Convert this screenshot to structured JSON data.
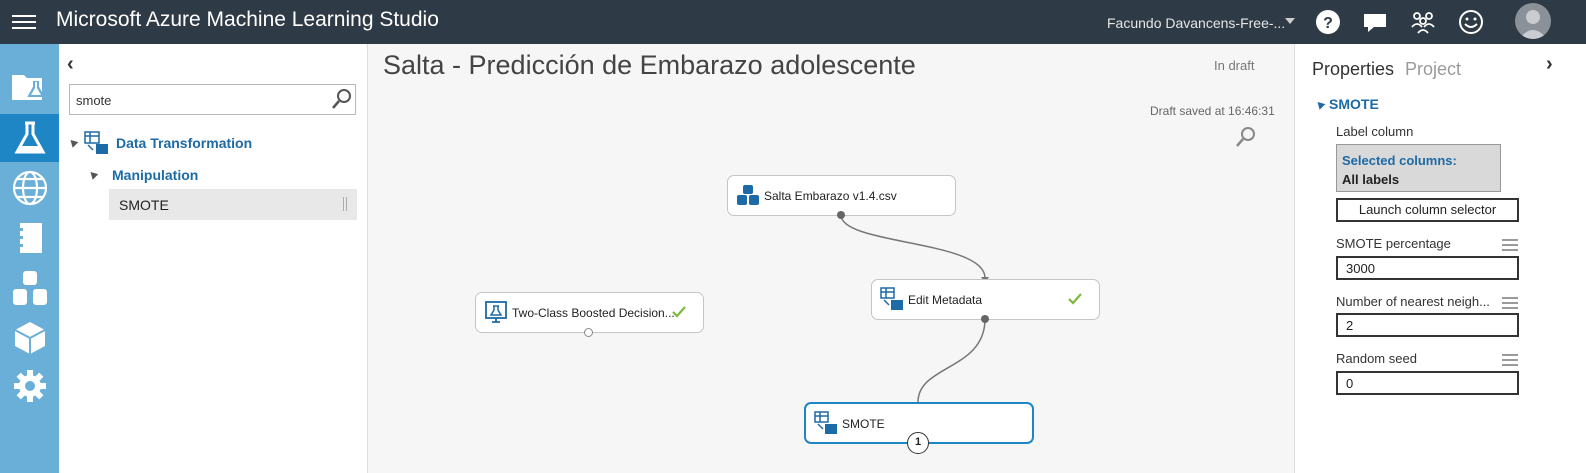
{
  "app": {
    "title": "Microsoft Azure Machine Learning Studio"
  },
  "header": {
    "workspace": "Facundo Davancens-Free-..."
  },
  "palette": {
    "search_value": "smote",
    "category": "Data Transformation",
    "subcategory": "Manipulation",
    "item": "SMOTE"
  },
  "canvas": {
    "experiment_title": "Salta - Predicción de Embarazo adolescente",
    "status": "In draft",
    "draft_saved": "Draft saved at 16:46:31",
    "nodes": {
      "dataset": "Salta Embarazo v1.4.csv",
      "model": "Two-Class Boosted Decision...",
      "edit_metadata": "Edit Metadata",
      "smote": "SMOTE",
      "smote_port": "1"
    }
  },
  "properties": {
    "tab_properties": "Properties",
    "tab_project": "Project",
    "section": "SMOTE",
    "label_column": "Label column",
    "selected_columns_title": "Selected columns:",
    "selected_columns_value": "All labels",
    "launch_button": "Launch column selector",
    "smote_percentage_label": "SMOTE percentage",
    "smote_percentage_value": "3000",
    "neighbors_label": "Number of nearest neigh...",
    "neighbors_value": "2",
    "seed_label": "Random seed",
    "seed_value": "0"
  },
  "colors": {
    "topbar": "#2e3a45",
    "nav": "#6aafd8",
    "nav_active": "#1f86c6",
    "accent": "#1c6aa6",
    "check": "#7cba3e"
  }
}
